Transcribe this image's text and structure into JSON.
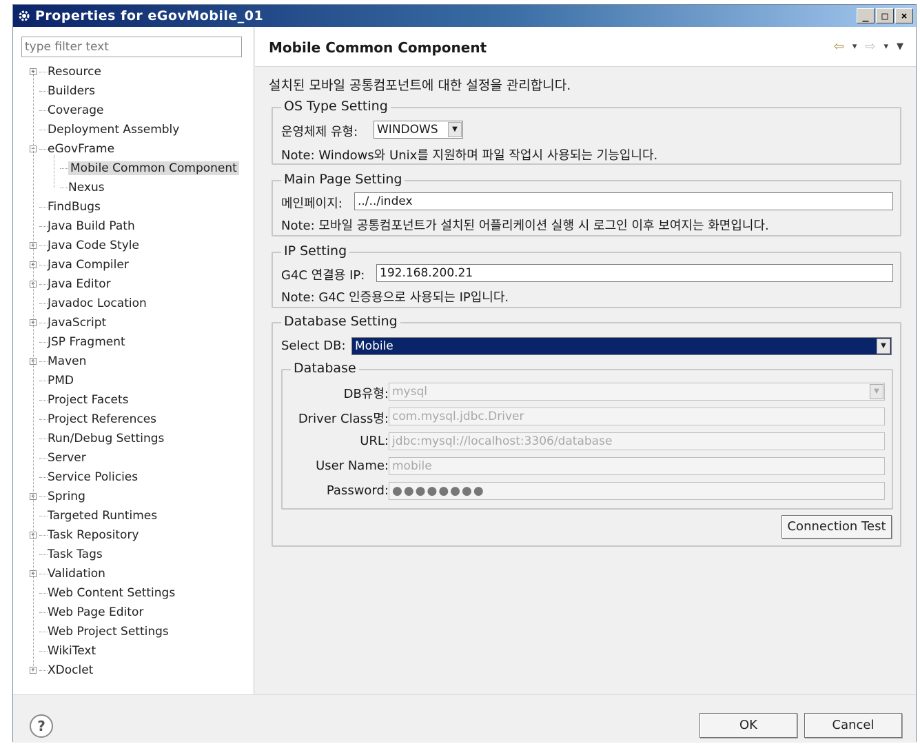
{
  "window": {
    "title": "Properties for eGovMobile_01"
  },
  "left": {
    "filter_placeholder": "type filter text",
    "tree": [
      {
        "label": "Resource",
        "expandable": true
      },
      {
        "label": "Builders"
      },
      {
        "label": "Coverage"
      },
      {
        "label": "Deployment Assembly"
      },
      {
        "label": "eGovFrame",
        "expandable": true,
        "expanded": true
      },
      {
        "label": "Mobile Common Component",
        "selected": true
      },
      {
        "label": "Nexus"
      },
      {
        "label": "FindBugs"
      },
      {
        "label": "Java Build Path"
      },
      {
        "label": "Java Code Style",
        "expandable": true
      },
      {
        "label": "Java Compiler",
        "expandable": true
      },
      {
        "label": "Java Editor",
        "expandable": true
      },
      {
        "label": "Javadoc Location"
      },
      {
        "label": "JavaScript",
        "expandable": true
      },
      {
        "label": "JSP Fragment"
      },
      {
        "label": "Maven",
        "expandable": true
      },
      {
        "label": "PMD"
      },
      {
        "label": "Project Facets"
      },
      {
        "label": "Project References"
      },
      {
        "label": "Run/Debug Settings"
      },
      {
        "label": "Server"
      },
      {
        "label": "Service Policies"
      },
      {
        "label": "Spring",
        "expandable": true
      },
      {
        "label": "Targeted Runtimes"
      },
      {
        "label": "Task Repository",
        "expandable": true
      },
      {
        "label": "Task Tags"
      },
      {
        "label": "Validation",
        "expandable": true
      },
      {
        "label": "Web Content Settings"
      },
      {
        "label": "Web Page Editor"
      },
      {
        "label": "Web Project Settings"
      },
      {
        "label": "WikiText"
      },
      {
        "label": "XDoclet",
        "expandable": true
      }
    ]
  },
  "main": {
    "title": "Mobile Common Component",
    "description": "설치된 모바일 공통컴포넌트에 대한 설정을 관리합니다.",
    "os_group": {
      "label": "OS Type Setting",
      "field_label": "운영체제 유형:",
      "value": "WINDOWS",
      "note": "Note: Windows와 Unix를 지원하며 파일 작업시 사용되는 기능입니다."
    },
    "main_page_group": {
      "label": "Main Page Setting",
      "field_label": "메인페이지:",
      "value": "../../index",
      "note": "Note: 모바일 공통컴포넌트가 설치된 어플리케이션 실행 시 로그인 이후 보여지는 화면입니다."
    },
    "ip_group": {
      "label": "IP Setting",
      "field_label": "G4C 연결용 IP:",
      "value": "192.168.200.21",
      "note": "Note: G4C 인증용으로 사용되는 IP입니다."
    },
    "db_group": {
      "label": "Database Setting",
      "select_label": "Select DB:",
      "select_value": "Mobile",
      "sub_label": "Database",
      "db_type_label": "DB유형:",
      "db_type_value": "mysql",
      "driver_label": "Driver Class명:",
      "driver_value": "com.mysql.jdbc.Driver",
      "url_label": "URL:",
      "url_value": "jdbc:mysql://localhost:3306/database",
      "user_label": "User Name:",
      "user_value": "mobile",
      "password_label": "Password:",
      "password_value": "●●●●●●●●",
      "test_button": "Connection Test"
    }
  },
  "footer": {
    "help": "?",
    "ok": "OK",
    "cancel": "Cancel"
  },
  "icons": {
    "app": "gear-icon",
    "back": "back-arrow-icon",
    "forward": "forward-arrow-icon",
    "menu": "view-menu-icon"
  }
}
